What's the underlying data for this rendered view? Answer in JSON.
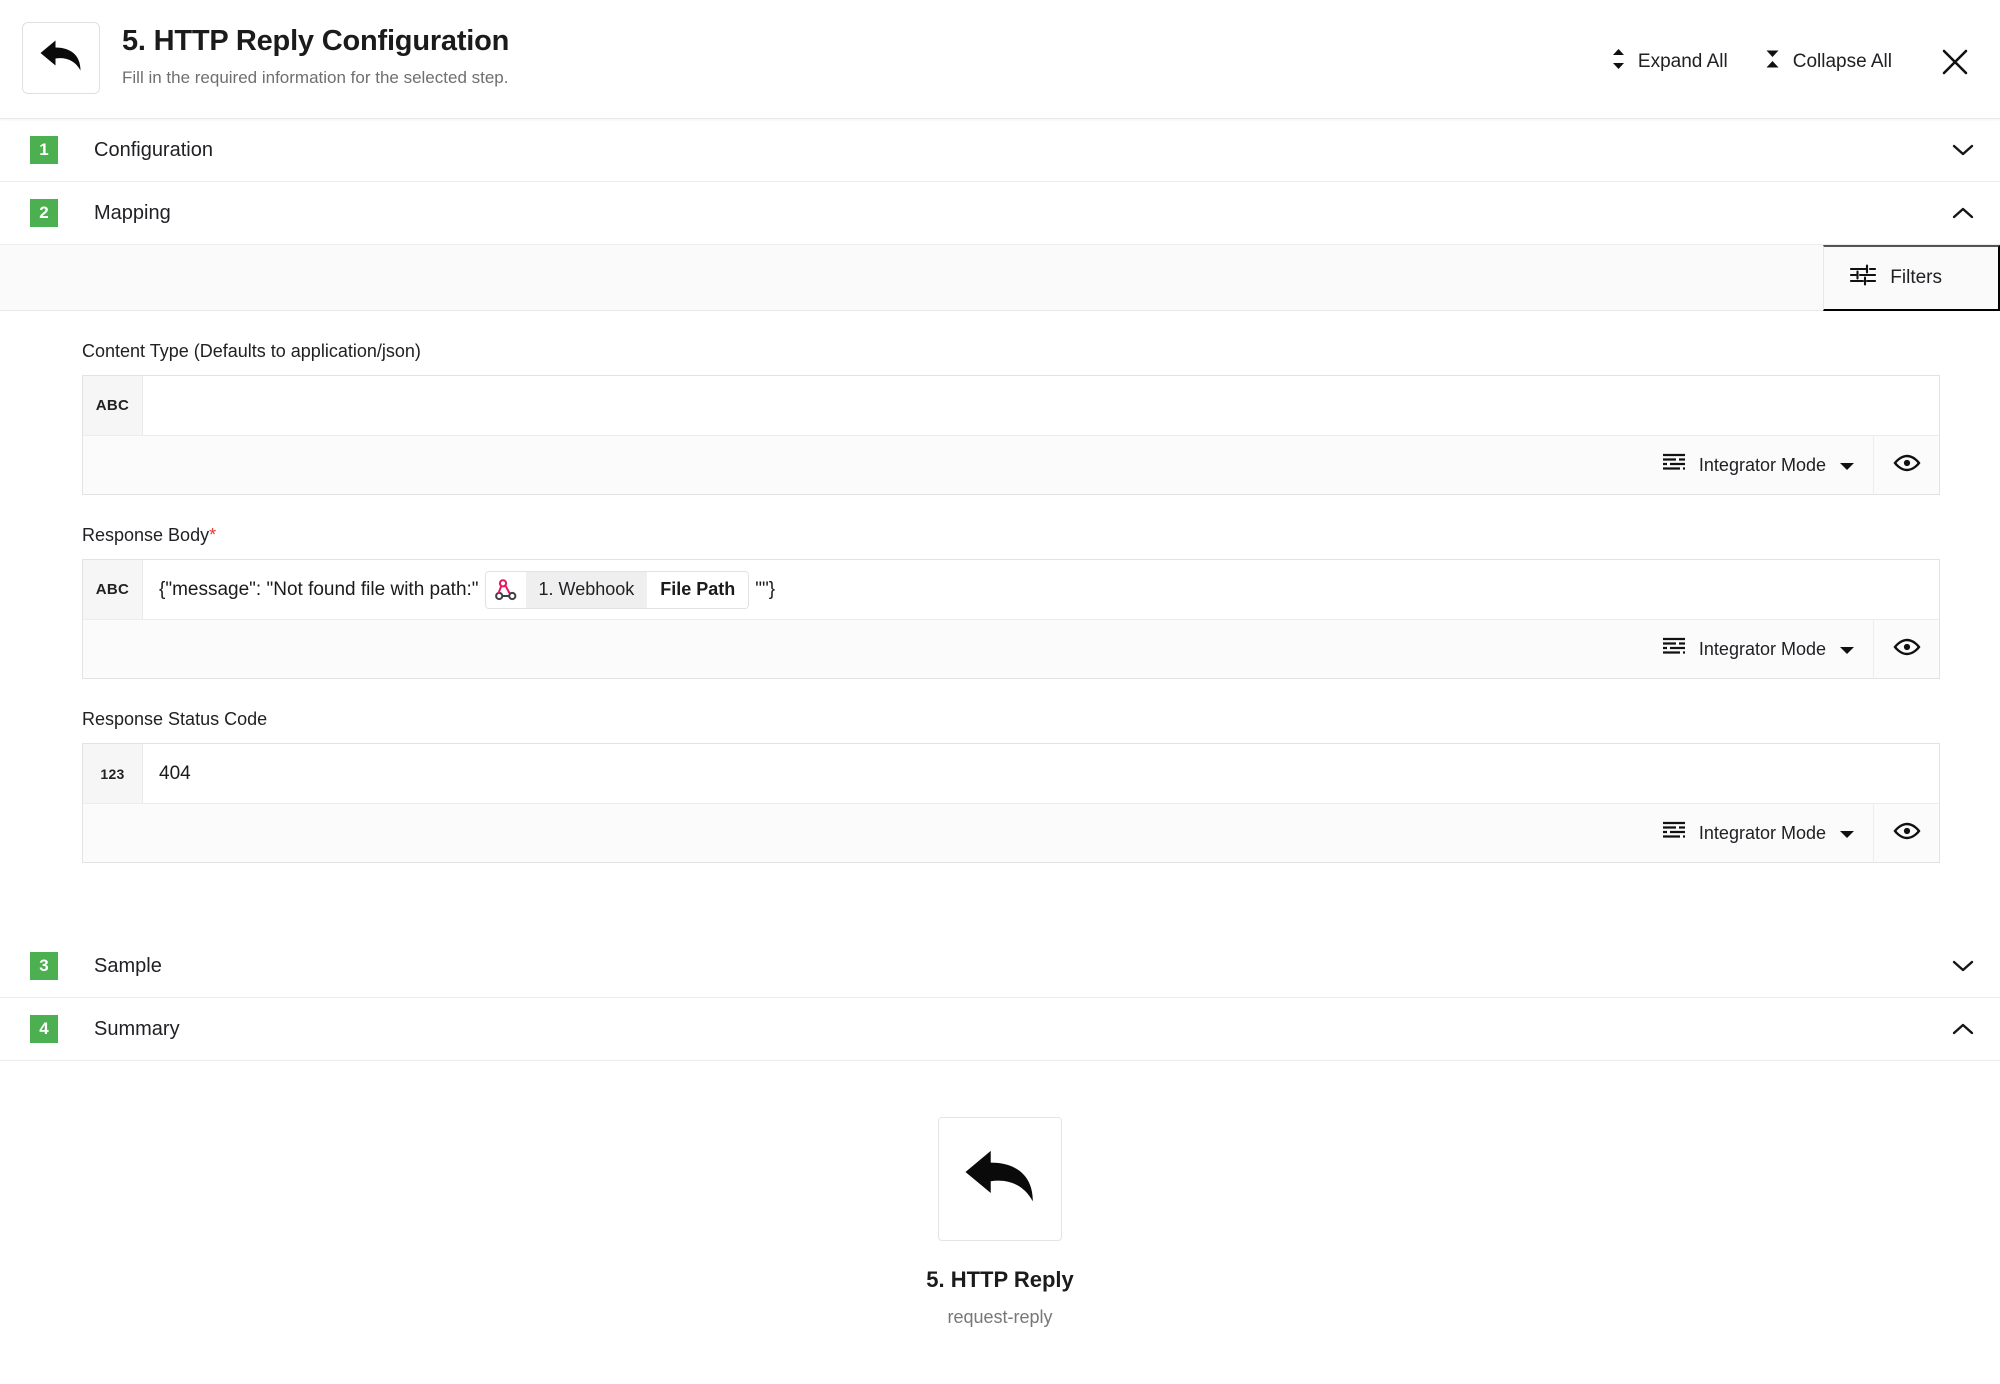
{
  "header": {
    "icon": "reply-arrow-icon",
    "title": "5. HTTP Reply Configuration",
    "subtitle": "Fill in the required information for the selected step.",
    "expand_all_label": "Expand All",
    "collapse_all_label": "Collapse All",
    "expand_icon": "expand-vertical-icon",
    "collapse_icon": "collapse-vertical-icon",
    "close_icon": "close-icon"
  },
  "accent_color": "#4caf50",
  "sections": [
    {
      "number": "1",
      "title": "Configuration",
      "expanded": false,
      "chevron": "chevron-down-icon"
    },
    {
      "number": "2",
      "title": "Mapping",
      "expanded": true,
      "chevron": "chevron-up-icon"
    },
    {
      "number": "3",
      "title": "Sample",
      "expanded": false,
      "chevron": "chevron-down-icon"
    },
    {
      "number": "4",
      "title": "Summary",
      "expanded": true,
      "chevron": "chevron-up-icon"
    }
  ],
  "mapping": {
    "filters_label": "Filters",
    "filters_icon": "tune-sliders-icon",
    "fields": [
      {
        "label": "Content Type (Defaults to application/json)",
        "required": false,
        "type_badge": "ABC",
        "value": "",
        "mode_label": "Integrator Mode",
        "mode_icon": "list-lines-icon",
        "dropdown_icon": "caret-down-icon",
        "preview_icon": "eye-icon"
      },
      {
        "label": "Response Body",
        "required": true,
        "required_marker": "*",
        "type_badge": "ABC",
        "value_prefix": "{\"message\": \"Not found file with path:\"",
        "value_suffix": "\"\"}",
        "token": {
          "icon": "webhook-icon",
          "icon_color": "#e5195e",
          "source": "1. Webhook",
          "field": "File Path"
        },
        "mode_label": "Integrator Mode",
        "mode_icon": "list-lines-icon",
        "dropdown_icon": "caret-down-icon",
        "preview_icon": "eye-icon"
      },
      {
        "label": "Response Status Code",
        "required": false,
        "type_badge": "123",
        "value": "404",
        "mode_label": "Integrator Mode",
        "mode_icon": "list-lines-icon",
        "dropdown_icon": "caret-down-icon",
        "preview_icon": "eye-icon"
      }
    ]
  },
  "summary": {
    "icon": "reply-arrow-icon",
    "step_name": "5. HTTP Reply",
    "step_type": "request-reply"
  }
}
